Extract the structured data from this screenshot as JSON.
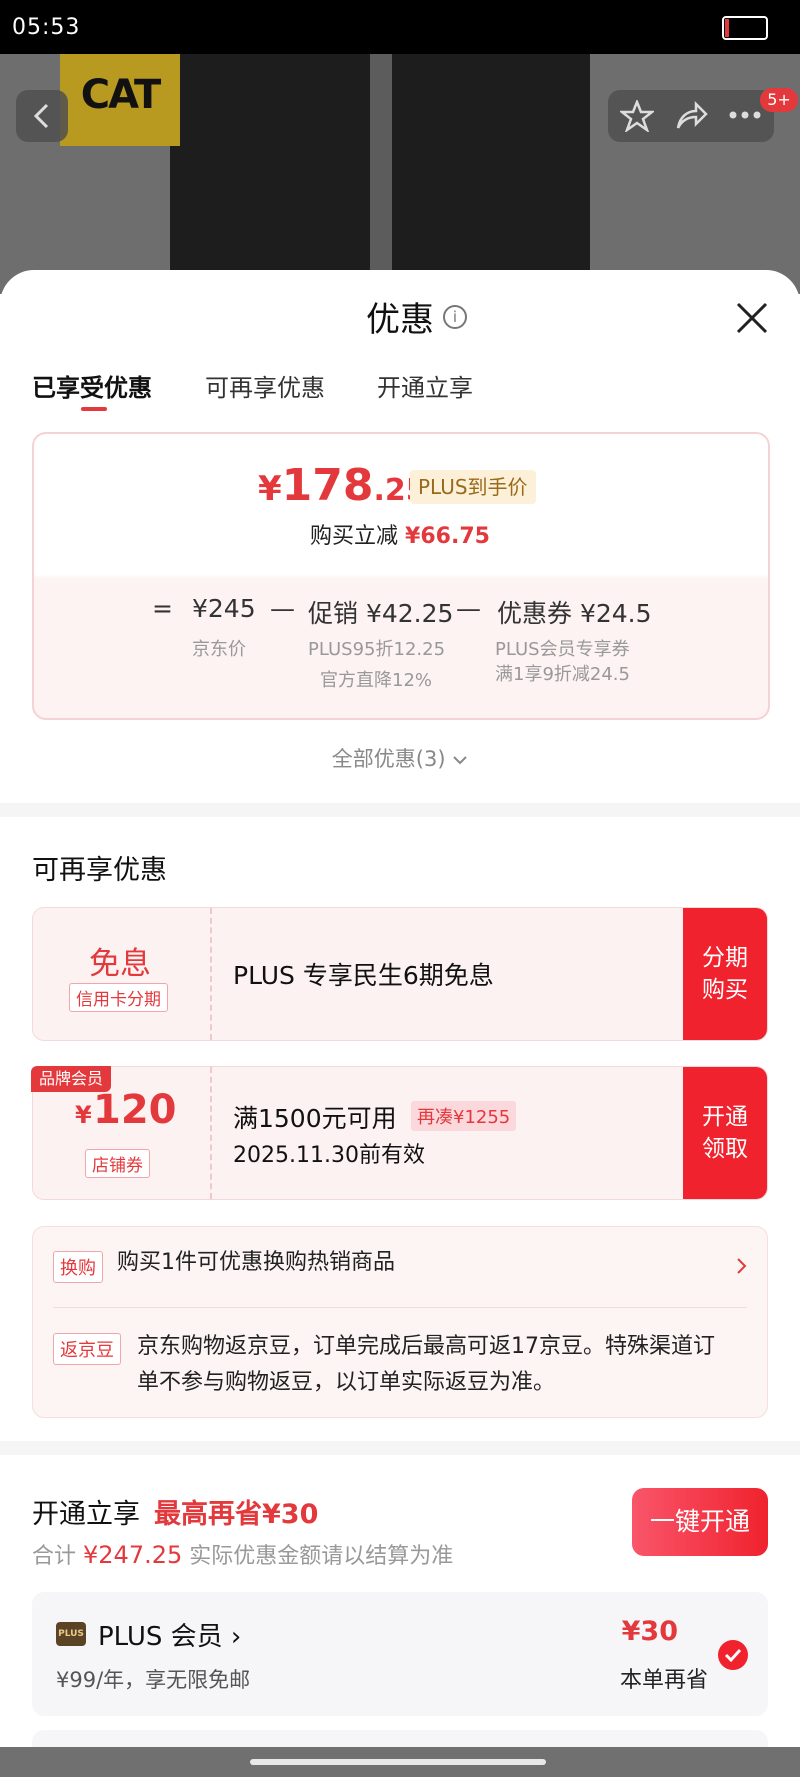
{
  "status_bar": {
    "time": "05:53"
  },
  "header": {
    "badge_count": "5+"
  },
  "sheet": {
    "title": "优惠",
    "tabs": [
      "已享受优惠",
      "可再享优惠",
      "开通立享"
    ]
  },
  "price_box": {
    "symbol": "¥",
    "price_int": "178",
    "price_dec": ".25",
    "plus_tag": "PLUS到手价",
    "reduce_label": "购买立减",
    "reduce_value": "¥66.75",
    "eq": "=",
    "minus": "—",
    "jd_price": "¥245",
    "jd_price_label": "京东价",
    "promo": "促销 ¥42.25",
    "promo_sub1": "PLUS95折12.25",
    "promo_sub2": "官方直降12%",
    "coupon": "优惠券 ¥24.5",
    "coupon_sub1": "PLUS会员专享券",
    "coupon_sub2": "满1享9折减24.5"
  },
  "all_promos": "全部优惠(3)",
  "more_section": {
    "title": "可再享优惠",
    "installment": {
      "big": "免息",
      "tag": "信用卡分期",
      "text": "PLUS 专享民生6期免息",
      "action_line1": "分期",
      "action_line2": "购买"
    },
    "coupon": {
      "flag": "品牌会员",
      "symbol": "¥",
      "amount": "120",
      "tag": "店铺券",
      "cond": "满1500元可用",
      "zaicou": "再凑¥1255",
      "expiry": "2025.11.30前有效",
      "action_line1": "开通",
      "action_line2": "领取"
    },
    "exchange": {
      "tag": "换购",
      "text": "购买1件可优惠换购热销商品"
    },
    "beans": {
      "tag": "返京豆",
      "text_line1": "京东购物返京豆，订单完成后最高可返17京豆。特殊渠道订",
      "text_line2": "单不参与购物返豆，以订单实际返豆为准。"
    }
  },
  "open_section": {
    "title": "开通立享",
    "highlight": "最高再省¥30",
    "total_label": "合计",
    "total_value": "¥247.25",
    "total_note": "实际优惠金额请以结算为准",
    "button": "一键开通",
    "plus": {
      "icon_text": "PLUS",
      "name": "PLUS 会员 ›",
      "desc": "¥99/年，享无限免邮",
      "save_amount": "¥30",
      "save_label": "本单再省"
    }
  }
}
